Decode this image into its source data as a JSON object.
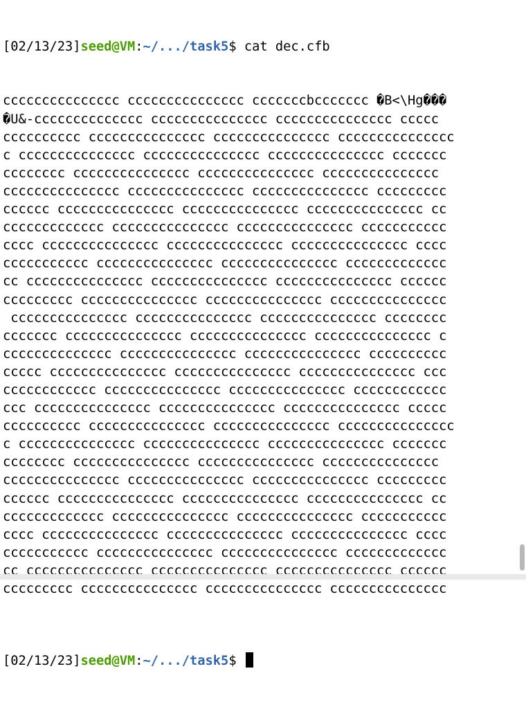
{
  "command_prompt": {
    "timestamp": "[02/13/23]",
    "user_host": "seed@VM",
    "colon": ":",
    "path": "~/.../task5",
    "symbol": "$",
    "command": " cat dec.cfb"
  },
  "output_lines": [
    "ccccccccccccccc ccccccccccccccc cccccccbccccccc �B<\\Hg���",
    "�U&-cccccccccccccc ccccccccccccccc ccccccccccccccc ccccc",
    "cccccccccc ccccccccccccccc ccccccccccccccc ccccccccccccccc",
    "c ccccccccccccccc ccccccccccccccc ccccccccccccccc ccccccc",
    "cccccccc ccccccccccccccc ccccccccccccccc ccccccccccccccc",
    "ccccccccccccccc ccccccccccccccc ccccccccccccccc ccccccccc",
    "cccccc ccccccccccccccc ccccccccccccccc ccccccccccccccc cc",
    "ccccccccccccc ccccccccccccccc ccccccccccccccc ccccccccccc",
    "cccc ccccccccccccccc ccccccccccccccc ccccccccccccccc cccc",
    "ccccccccccc ccccccccccccccc ccccccccccccccc ccccccccccccc",
    "cc ccccccccccccccc ccccccccccccccc ccccccccccccccc cccccc",
    "ccccccccc ccccccccccccccc ccccccccccccccc ccccccccccccccc",
    " ccccccccccccccc ccccccccccccccc ccccccccccccccc cccccccc",
    "ccccccc ccccccccccccccc ccccccccccccccc ccccccccccccccc c",
    "cccccccccccccc ccccccccccccccc ccccccccccccccc cccccccccc",
    "ccccc ccccccccccccccc ccccccccccccccc ccccccccccccccc ccc",
    "cccccccccccc ccccccccccccccc ccccccccccccccc cccccccccccc",
    "ccc ccccccccccccccc ccccccccccccccc ccccccccccccccc ccccc",
    "cccccccccc ccccccccccccccc ccccccccccccccc ccccccccccccccc",
    "c ccccccccccccccc ccccccccccccccc ccccccccccccccc ccccccc",
    "cccccccc ccccccccccccccc ccccccccccccccc ccccccccccccccc",
    "ccccccccccccccc ccccccccccccccc ccccccccccccccc ccccccccc",
    "cccccc ccccccccccccccc ccccccccccccccc ccccccccccccccc cc",
    "ccccccccccccc ccccccccccccccc ccccccccccccccc ccccccccccc",
    "cccc ccccccccccccccc ccccccccccccccc ccccccccccccccc cccc",
    "ccccccccccc ccccccccccccccc ccccccccccccccc ccccccccccccc",
    "cc ccccccccccccccc ccccccccccccccc ccccccccccccccc cccccc",
    "ccccccccc ccccccccccccccc ccccccccccccccc ccccccccccccccc",
    ""
  ],
  "final_prompt": {
    "timestamp": "[02/13/23]",
    "user_host": "seed@VM",
    "colon": ":",
    "path": "~/.../task5",
    "symbol": "$",
    "command": " "
  },
  "colors": {
    "user_host": "#4e9a06",
    "path": "#3465a4",
    "text": "#000000",
    "background": "#ffffff"
  }
}
